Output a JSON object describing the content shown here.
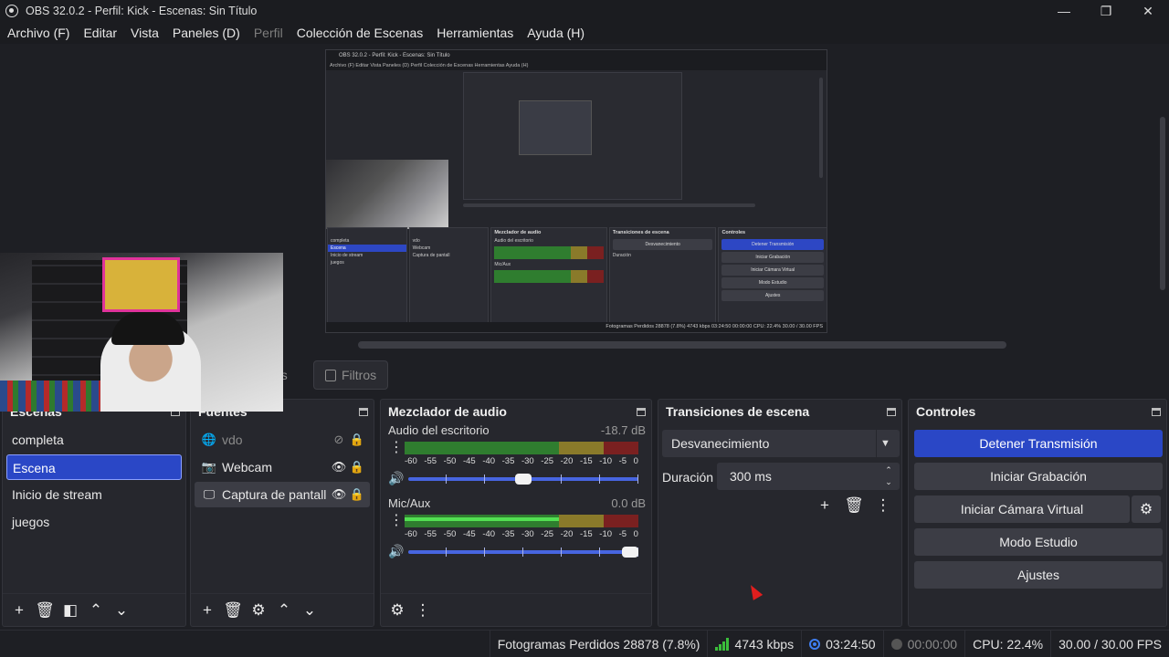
{
  "window": {
    "title": "OBS 32.0.2 - Perfil: Kick - Escenas: Sin Título",
    "controls": {
      "minimize": "—",
      "maximize": "❐",
      "close": "✕"
    }
  },
  "menu": {
    "items": [
      "Archivo (F)",
      "Editar",
      "Vista",
      "Paneles (D)",
      "Perfil",
      "Colección de Escenas",
      "Herramientas",
      "Ayuda (H)"
    ],
    "disabled_index": 4
  },
  "preview": {
    "mini_title": "OBS 32.0.2 - Perfil: Kick - Escenas: Sin Título",
    "mini_menu": "Archivo (F)   Editar   Vista   Paneles (D)   Perfil   Colección de Escenas   Herramientas   Ayuda (H)",
    "mini_docks": {
      "mixer": "Mezclador de audio",
      "transitions": "Transiciones de escena",
      "controls": "Controles"
    },
    "mini_scenes": [
      "completa",
      "Escena",
      "Inicio de stream",
      "juegos"
    ],
    "mini_sources": [
      "vdo",
      "Webcam",
      "Captura de pantall"
    ],
    "mini_mixer": [
      "Audio del escritorio",
      "Mic/Aux"
    ],
    "mini_transition": [
      "Desvanecimiento",
      "Duración"
    ],
    "mini_controls": [
      "Detener Transmisión",
      "Iniciar Grabación",
      "Iniciar Cámara Virtual",
      "Modo Estudio",
      "Ajustes"
    ],
    "mini_filters": "Filtros",
    "mini_status": "Fotogramas Perdidos 28878 (7.8%)   4743 kbps   03:24:50   00:00:00   CPU: 22.4%   30.00 / 30.00 FPS"
  },
  "toolbar": {
    "properties_fragment": "es",
    "filters_label": "Filtros"
  },
  "scenes": {
    "title": "Escenas",
    "items": [
      "completa",
      "Escena",
      "Inicio de stream",
      "juegos"
    ],
    "selected_index": 1
  },
  "sources": {
    "title": "Fuentes",
    "items": [
      {
        "name": "vdo",
        "icon": "globe-icon",
        "visible": false,
        "locked": true
      },
      {
        "name": "Webcam",
        "icon": "camera-icon",
        "visible": true,
        "locked": true
      },
      {
        "name": "Captura de pantall",
        "icon": "monitor-icon",
        "visible": true,
        "locked": true
      }
    ],
    "selected_index": 2
  },
  "mixer": {
    "title": "Mezclador de audio",
    "scale": [
      "-60",
      "-55",
      "-50",
      "-45",
      "-40",
      "-35",
      "-30",
      "-25",
      "-20",
      "-15",
      "-10",
      "-5",
      "0"
    ],
    "tracks": [
      {
        "name": "Audio del escritorio",
        "db": "-18.7 dB",
        "level_fraction": 0.0,
        "volume_fraction": 0.5
      },
      {
        "name": "Mic/Aux",
        "db": "0.0 dB",
        "level_fraction": 0.66,
        "volume_fraction": 1.0
      }
    ]
  },
  "transitions": {
    "title": "Transiciones de escena",
    "selected": "Desvanecimiento",
    "duration_label": "Duración",
    "duration_value": "300 ms"
  },
  "controls": {
    "title": "Controles",
    "buttons": [
      "Detener Transmisión",
      "Iniciar Grabación",
      "Iniciar Cámara Virtual",
      "Modo Estudio",
      "Ajustes"
    ]
  },
  "status": {
    "dropped_frames": "Fotogramas Perdidos 28878 (7.8%)",
    "bitrate": "4743 kbps",
    "stream_time": "03:24:50",
    "record_time": "00:00:00",
    "cpu": "CPU: 22.4%",
    "fps": "30.00 / 30.00 FPS"
  },
  "colors": {
    "accent": "#2a47c6",
    "meter_green": "#2f7d2f",
    "meter_yellow": "#8a7a2a",
    "meter_red": "#7a2020",
    "signal_green": "#3bbf3b",
    "live_blue": "#3f7ef0"
  }
}
